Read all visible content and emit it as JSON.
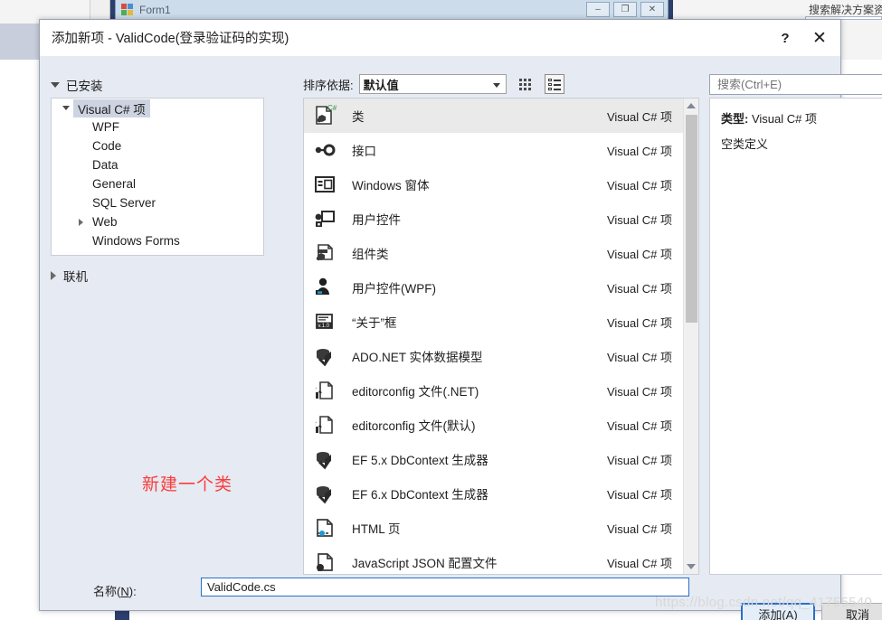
{
  "background": {
    "form_window_title": "Form1",
    "form_minimize": "–",
    "form_restore": "❐",
    "form_close": "✕",
    "solution_search_label": "搜索解决方案资"
  },
  "dialog": {
    "title": "添加新项 - ValidCode(登录验证码的实现)",
    "help_label": "?",
    "close_label": "✕"
  },
  "sidebar": {
    "installed_label": "已安装",
    "online_label": "联机",
    "items": [
      {
        "label": "Visual C# 项",
        "indent": 0,
        "expanded": true,
        "selected": true,
        "has_arrow": true
      },
      {
        "label": "WPF",
        "indent": 1,
        "expanded": false,
        "selected": false,
        "has_arrow": false
      },
      {
        "label": "Code",
        "indent": 1,
        "expanded": false,
        "selected": false,
        "has_arrow": false
      },
      {
        "label": "Data",
        "indent": 1,
        "expanded": false,
        "selected": false,
        "has_arrow": false
      },
      {
        "label": "General",
        "indent": 1,
        "expanded": false,
        "selected": false,
        "has_arrow": false
      },
      {
        "label": "SQL Server",
        "indent": 1,
        "expanded": false,
        "selected": false,
        "has_arrow": false
      },
      {
        "label": "Web",
        "indent": 1,
        "expanded": false,
        "selected": false,
        "has_arrow": true
      },
      {
        "label": "Windows Forms",
        "indent": 1,
        "expanded": false,
        "selected": false,
        "has_arrow": false
      }
    ]
  },
  "annotation": {
    "text": "新建一个类",
    "color": "#fa3c3c"
  },
  "toolbar": {
    "sort_label": "排序依据:",
    "sort_value": "默认值",
    "view_small_icons": "small-icons-view",
    "view_list": "list-view"
  },
  "search": {
    "placeholder": "搜索(Ctrl+E)",
    "value": ""
  },
  "list": {
    "kind_label": "Visual C# 项",
    "items": [
      {
        "name": "类",
        "kind": "Visual C# 项",
        "icon": "class-icon",
        "selected": true
      },
      {
        "name": "接口",
        "kind": "Visual C# 项",
        "icon": "interface-icon",
        "selected": false
      },
      {
        "name": "Windows 窗体",
        "kind": "Visual C# 项",
        "icon": "windows-form-icon",
        "selected": false
      },
      {
        "name": "用户控件",
        "kind": "Visual C# 项",
        "icon": "user-control-icon",
        "selected": false
      },
      {
        "name": "组件类",
        "kind": "Visual C# 项",
        "icon": "component-class-icon",
        "selected": false
      },
      {
        "name": "用户控件(WPF)",
        "kind": "Visual C# 项",
        "icon": "user-control-wpf-icon",
        "selected": false
      },
      {
        "name": "“关于”框",
        "kind": "Visual C# 项",
        "icon": "about-box-icon",
        "selected": false
      },
      {
        "name": "ADO.NET 实体数据模型",
        "kind": "Visual C# 项",
        "icon": "ado-net-model-icon",
        "selected": false
      },
      {
        "name": "editorconfig 文件(.NET)",
        "kind": "Visual C# 项",
        "icon": "editorconfig-icon",
        "selected": false
      },
      {
        "name": "editorconfig 文件(默认)",
        "kind": "Visual C# 项",
        "icon": "editorconfig-icon",
        "selected": false
      },
      {
        "name": "EF 5.x DbContext 生成器",
        "kind": "Visual C# 项",
        "icon": "ado-net-model-icon",
        "selected": false
      },
      {
        "name": "EF 6.x DbContext 生成器",
        "kind": "Visual C# 项",
        "icon": "ado-net-model-icon",
        "selected": false
      },
      {
        "name": "HTML 页",
        "kind": "Visual C# 项",
        "icon": "html-page-icon",
        "selected": false
      },
      {
        "name": "JavaScript JSON 配置文件",
        "kind": "Visual C# 项",
        "icon": "json-file-icon",
        "selected": false
      }
    ]
  },
  "details": {
    "type_key": "类型:",
    "type_value": "Visual C# 项",
    "description": "空类定义"
  },
  "footer": {
    "name_label_prefix": "名称(",
    "name_label_key": "N",
    "name_label_suffix": "):",
    "name_value": "ValidCode.cs",
    "add_label": "添加(A)",
    "cancel_label": "取消"
  },
  "watermark": {
    "text": "https://blog.csdn.net/qq_41755540"
  }
}
